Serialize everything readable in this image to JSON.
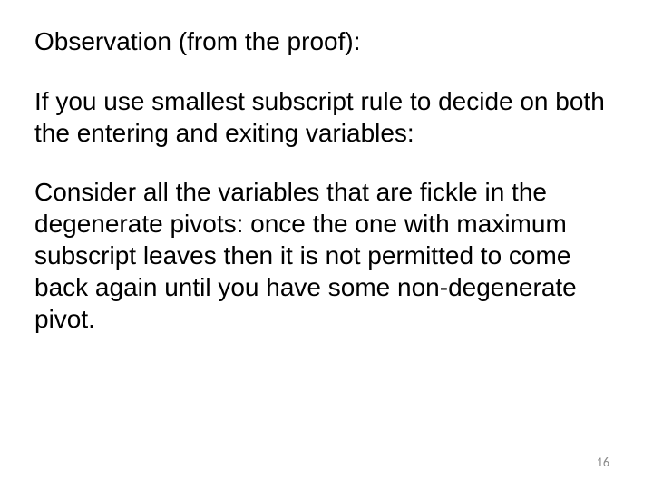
{
  "heading": "Observation (from the proof):",
  "para1": "If you use smallest subscript rule to decide on both the entering and exiting variables:",
  "para2": "Consider all the variables that are fickle in the degenerate pivots: once the one with maximum subscript leaves then it is not permitted to come back again until you have some non-degenerate pivot.",
  "page_number": "16"
}
